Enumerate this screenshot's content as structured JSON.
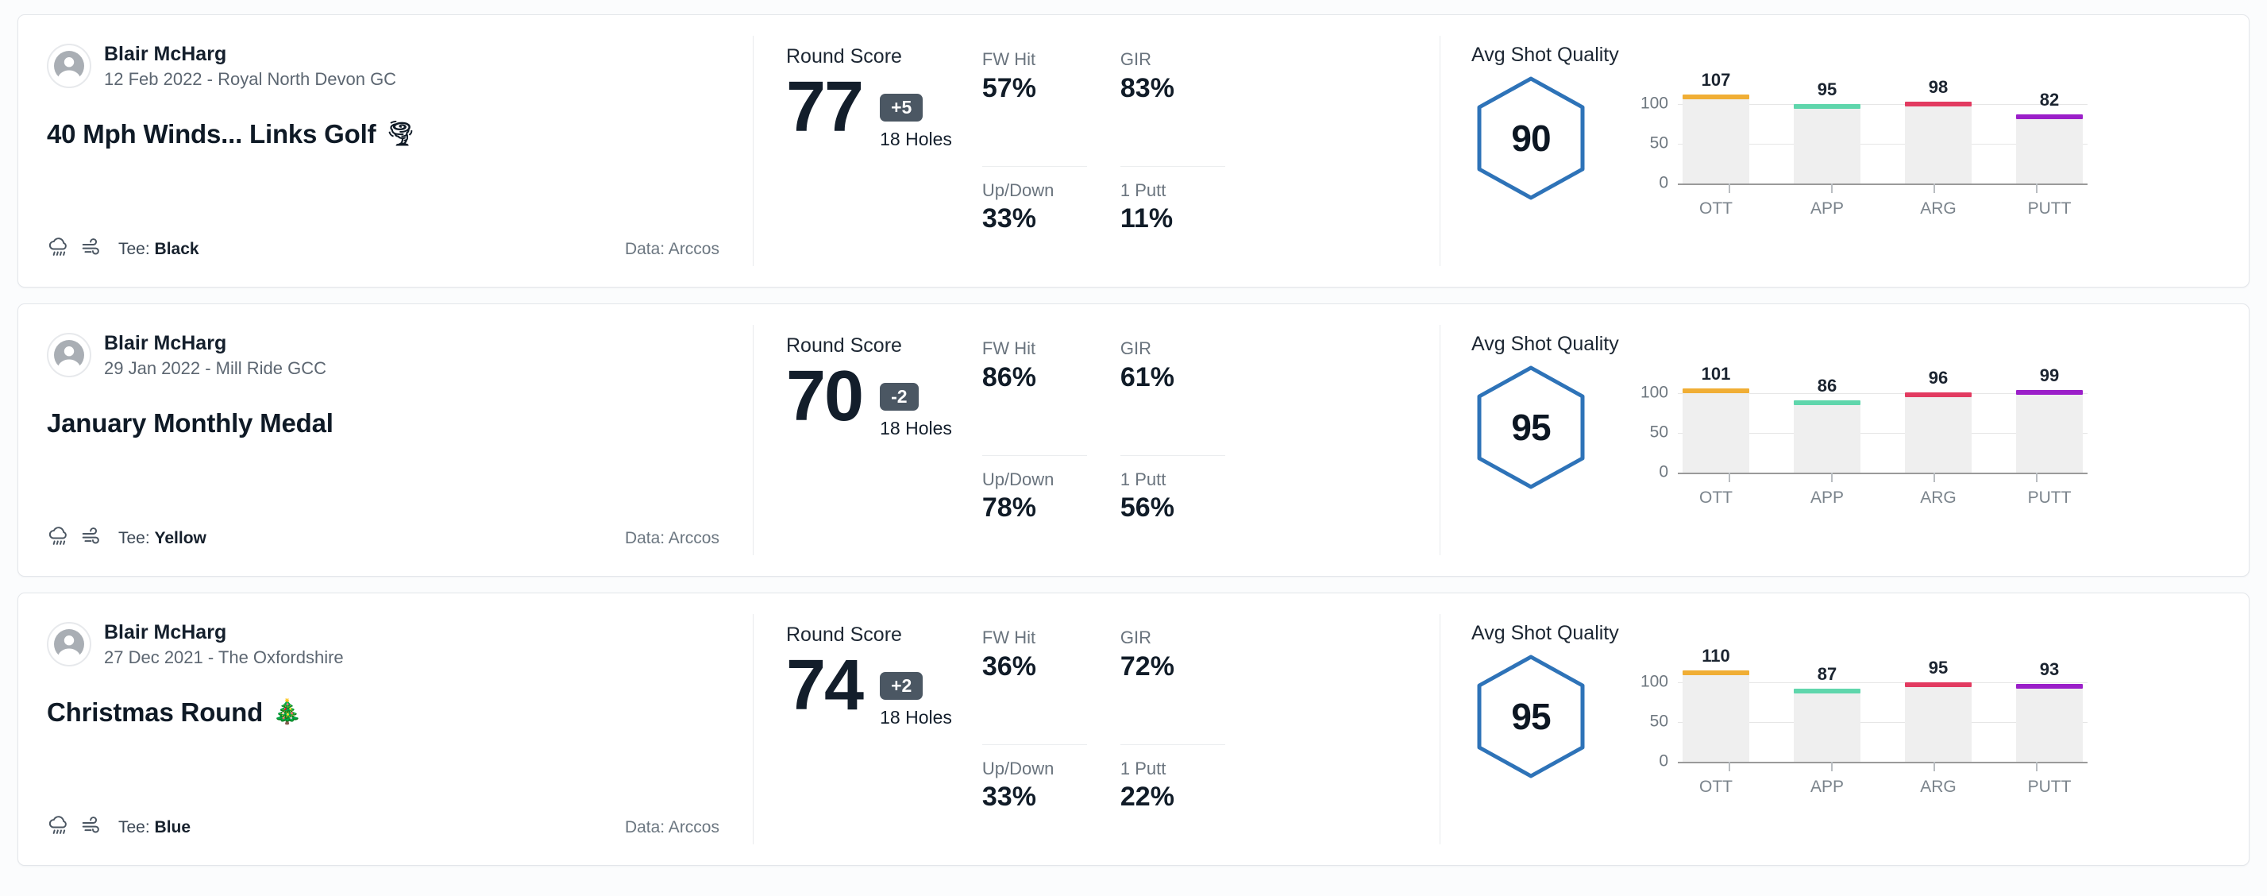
{
  "labels": {
    "round_score": "Round Score",
    "holes": "18 Holes",
    "avg_shot_quality": "Avg Shot Quality",
    "tee_prefix": "Tee: ",
    "data_prefix": "Data: ",
    "fw_hit": "FW Hit",
    "gir": "GIR",
    "up_down": "Up/Down",
    "one_putt": "1 Putt"
  },
  "chart_axis": {
    "yticks": [
      "100",
      "50",
      "0"
    ],
    "categories": [
      "OTT",
      "APP",
      "ARG",
      "PUTT"
    ],
    "ylim_max": 125
  },
  "colors": {
    "ott": "#F0AE35",
    "app": "#5FD6AC",
    "arg": "#E23A60",
    "putt": "#9B1FC9",
    "hex_stroke": "#2E73B8",
    "badge_bg": "#4B5763",
    "bar_track": "#EFEFEF"
  },
  "rounds": [
    {
      "user_name": "Blair McHarg",
      "meta": "12 Feb 2022 - Royal North Devon GC",
      "title": "40 Mph Winds... Links Golf",
      "title_emoji": "🌪",
      "tee": "Black",
      "data_source": "Arccos",
      "score": "77",
      "to_par": "+5",
      "holes": "18 Holes",
      "stats": {
        "fw_hit": "57%",
        "gir": "83%",
        "up_down": "33%",
        "one_putt": "11%"
      },
      "avg_shot_quality": "90",
      "chart_data": {
        "type": "bar",
        "title": "Avg Shot Quality",
        "categories": [
          "OTT",
          "APP",
          "ARG",
          "PUTT"
        ],
        "values": [
          107,
          95,
          98,
          82
        ],
        "colors": [
          "#F0AE35",
          "#5FD6AC",
          "#E23A60",
          "#9B1FC9"
        ],
        "ylabel": "",
        "xlabel": "",
        "ylim": [
          0,
          125
        ],
        "yticks": [
          0,
          50,
          100
        ],
        "grid": true,
        "legend": "none"
      }
    },
    {
      "user_name": "Blair McHarg",
      "meta": "29 Jan 2022 - Mill Ride GCC",
      "title": "January Monthly Medal",
      "title_emoji": "",
      "tee": "Yellow",
      "data_source": "Arccos",
      "score": "70",
      "to_par": "-2",
      "holes": "18 Holes",
      "stats": {
        "fw_hit": "86%",
        "gir": "61%",
        "up_down": "78%",
        "one_putt": "56%"
      },
      "avg_shot_quality": "95",
      "chart_data": {
        "type": "bar",
        "title": "Avg Shot Quality",
        "categories": [
          "OTT",
          "APP",
          "ARG",
          "PUTT"
        ],
        "values": [
          101,
          86,
          96,
          99
        ],
        "colors": [
          "#F0AE35",
          "#5FD6AC",
          "#E23A60",
          "#9B1FC9"
        ],
        "ylabel": "",
        "xlabel": "",
        "ylim": [
          0,
          125
        ],
        "yticks": [
          0,
          50,
          100
        ],
        "grid": true,
        "legend": "none"
      }
    },
    {
      "user_name": "Blair McHarg",
      "meta": "27 Dec 2021 - The Oxfordshire",
      "title": "Christmas Round",
      "title_emoji": "🎄",
      "tee": "Blue",
      "data_source": "Arccos",
      "score": "74",
      "to_par": "+2",
      "holes": "18 Holes",
      "stats": {
        "fw_hit": "36%",
        "gir": "72%",
        "up_down": "33%",
        "one_putt": "22%"
      },
      "avg_shot_quality": "95",
      "chart_data": {
        "type": "bar",
        "title": "Avg Shot Quality",
        "categories": [
          "OTT",
          "APP",
          "ARG",
          "PUTT"
        ],
        "values": [
          110,
          87,
          95,
          93
        ],
        "colors": [
          "#F0AE35",
          "#5FD6AC",
          "#E23A60",
          "#9B1FC9"
        ],
        "ylabel": "",
        "xlabel": "",
        "ylim": [
          0,
          125
        ],
        "yticks": [
          0,
          50,
          100
        ],
        "grid": true,
        "legend": "none"
      }
    }
  ]
}
